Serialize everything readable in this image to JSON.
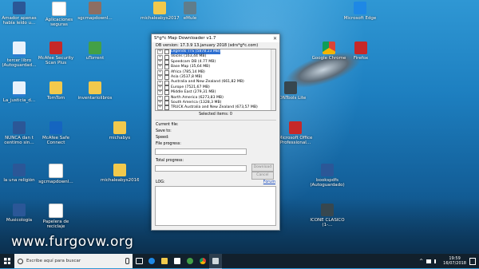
{
  "desktop": {
    "icons": [
      {
        "label": "Amador apenas había leído u…",
        "glyph": "g-word"
      },
      {
        "label": "Aplicaciones seguras",
        "glyph": "g-doc"
      },
      {
        "label": "sgcmapdownl…",
        "glyph": "g-img"
      },
      {
        "label": "michaleabys2017",
        "glyph": "g-folder"
      },
      {
        "label": "eMule",
        "glyph": "g-gear"
      },
      {
        "label": "tercer libro (Autoguardad…",
        "glyph": "g-pdf"
      },
      {
        "label": "McAfee Security Scan Plus",
        "glyph": "g-red"
      },
      {
        "label": "uTorrent",
        "glyph": "g-green"
      },
      {
        "label": "La_justicia_d…",
        "glyph": "g-pdf"
      },
      {
        "label": "TomTom",
        "glyph": "g-folder"
      },
      {
        "label": "inventariolibros",
        "glyph": "g-folder"
      },
      {
        "label": "NUNCA dan t centimo sin…",
        "glyph": "g-word"
      },
      {
        "label": "McAfee Safe Connect",
        "glyph": "g-shield"
      },
      {
        "label": "michabys",
        "glyph": "g-folder"
      },
      {
        "label": "la una religión",
        "glyph": "g-word"
      },
      {
        "label": "sgcmapdownl…",
        "glyph": "g-doc"
      },
      {
        "label": "michaleabys2016",
        "glyph": "g-folder"
      },
      {
        "label": "Musicología",
        "glyph": "g-word"
      },
      {
        "label": "Papelera de reciclaje",
        "glyph": "g-doc"
      },
      {
        "label": "Microsoft Edge",
        "glyph": "g-blue"
      },
      {
        "label": "Google Chrome",
        "glyph": "g-chrome"
      },
      {
        "label": "Firefox",
        "glyph": "g-red"
      },
      {
        "label": "MONTools Lite",
        "glyph": "g-mon"
      },
      {
        "label": "Microsoft Office Professional…",
        "glyph": "g-red"
      },
      {
        "label": "bookspdfs (Autoguardado)",
        "glyph": "g-word"
      },
      {
        "label": "ICONE CLASICO (1-…",
        "glyph": "g-mon"
      }
    ]
  },
  "window": {
    "title": "S*g*c Map Downloader v1.7",
    "close_glyph": "✕",
    "db_version": "DB version: 17.3.9 13.january 2018 (sdrs*g*c.com)",
    "tree_items": [
      {
        "label": "Legends TTS (5878.23 MB)",
        "selected": true
      },
      {
        "label": "Voices (163,44 MB)",
        "selected": false
      },
      {
        "label": "Speedcam DB (4.77 MB)",
        "selected": false
      },
      {
        "label": "Base Map (35,64 MB)",
        "selected": false
      },
      {
        "label": "Africa (785,14 MB)",
        "selected": false
      },
      {
        "label": "Asia (3537,8 MB)",
        "selected": false
      },
      {
        "label": "Australia and New Zealand (661,82 MB)",
        "selected": false
      },
      {
        "label": "Europe (7521,67 MB)",
        "selected": false
      },
      {
        "label": "Middle East (279,31 MB)",
        "selected": false
      },
      {
        "label": "North America (6273,83 MB)",
        "selected": false
      },
      {
        "label": "South America (1328,3 MB)",
        "selected": false
      },
      {
        "label": "TRUCK Australia and New Zealand (673,57 MB)",
        "selected": false
      }
    ],
    "selected_items": "Selected items: 0",
    "current_file_label": "Current file:",
    "save_to_label": "Save to:",
    "speed_label": "Speed:",
    "file_progress_label": "File progress:",
    "total_progress_label": "Total progress:",
    "download_button": "Download",
    "cancel_button": "Cancel",
    "log_label": "LOG:",
    "forum_link": "Forum"
  },
  "watermark": "www.furgovw.org",
  "taskbar": {
    "search_placeholder": "Escribe aquí para buscar",
    "time": "19:59",
    "date": "16/07/2018"
  }
}
